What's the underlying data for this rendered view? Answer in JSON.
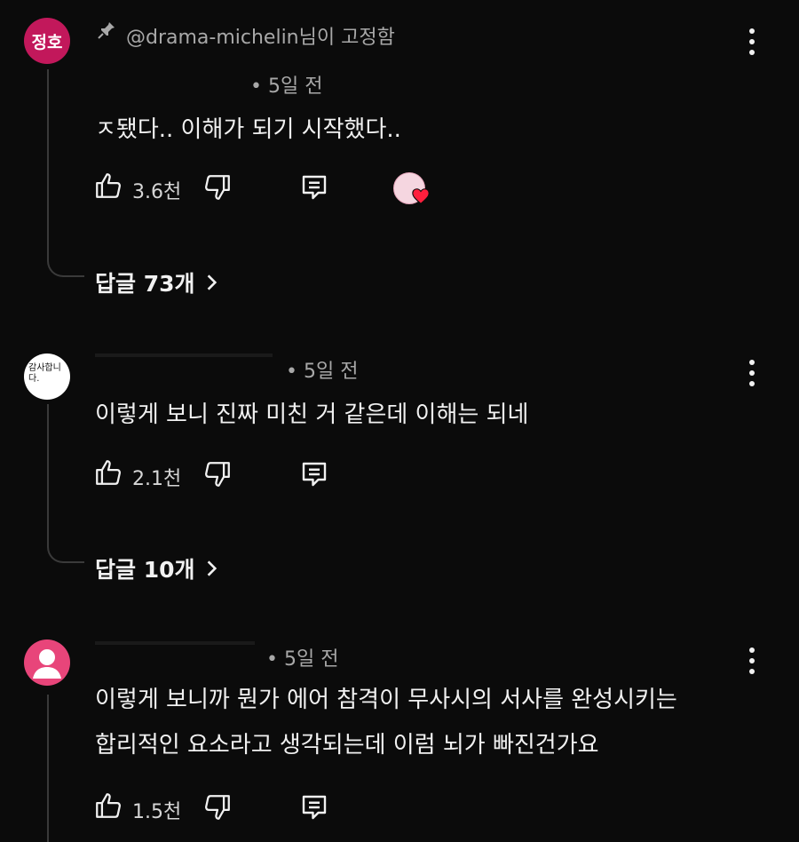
{
  "comments": [
    {
      "avatar_text": "정호",
      "avatar_color": "#c2185b",
      "pinned_by": "@drama-michelin님이 고정함",
      "pin_icon": "pin-icon",
      "time": "• 5일 전",
      "lines": [
        "ㅈ됐다.. 이해가 되기 시작했다.."
      ],
      "likes": "3.6천",
      "has_creator_heart": true,
      "replies_label": "답글 73개"
    },
    {
      "avatar_text": "감사합니다.",
      "avatar_color": "#ffffff",
      "time": "• 5일 전",
      "lines": [
        "이렇게 보니 진짜 미친 거 같은데 이해는 되네"
      ],
      "likes": "2.1천",
      "replies_label": "답글 10개"
    },
    {
      "avatar_color": "#e8457a",
      "time": "• 5일 전",
      "lines": [
        "이렇게 보니까 뭔가 에어 참격이 무사시의 서사를 완성시키는",
        "합리적인 요소라고 생각되는데 이럼  뇌가 빠진건가요"
      ],
      "likes": "1.5천"
    }
  ]
}
